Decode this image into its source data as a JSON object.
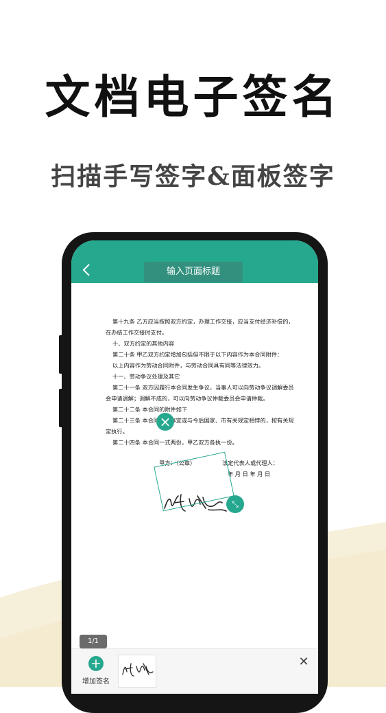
{
  "hero": {
    "title": "文档电子签名",
    "subtitle": "扫描手写签字&面板签字"
  },
  "app": {
    "accent_color": "#26a88f",
    "back_icon": "chevron-left-icon",
    "title_placeholder": "输入页面标题"
  },
  "document": {
    "lines": [
      "第十九条 乙方应当按照双方约定，办理工作交接，应当支付经济补偿的，",
      "在办结工作交接时支付。",
      "十、双方约定的其他内容",
      "第二十条 甲乙双方约定增加包括但不限于以下内容作为本合同附件：",
      "以上内容作为劳动合同附件，与劳动合同具有同等法律效力。",
      "十一、劳动争议处理及其它",
      "第二十一条 双方因履行本合同发生争议，当事人可以向劳动争议调解委员",
      "会申请调解；调解不成的，可以向劳动争议仲裁委员会申请仲裁。",
      "第二十二条 本合同的附件如下",
      "第二十三条 本合同未尽事宜或与今后国家、市有关规定相悖的，按有关规",
      "定执行。",
      "第二十四条 本合同一式两份，甲乙双方各执一份。",
      "甲方：（公章）",
      "法定代表人或代理人：",
      "年 月 日 年 月 日"
    ]
  },
  "signature": {
    "close_icon": "close-icon",
    "resize_icon": "resize-icon"
  },
  "pager": {
    "label": "1/1"
  },
  "bottom": {
    "add_label": "增加签名",
    "add_icon": "plus-icon",
    "close_icon": "close-icon"
  }
}
